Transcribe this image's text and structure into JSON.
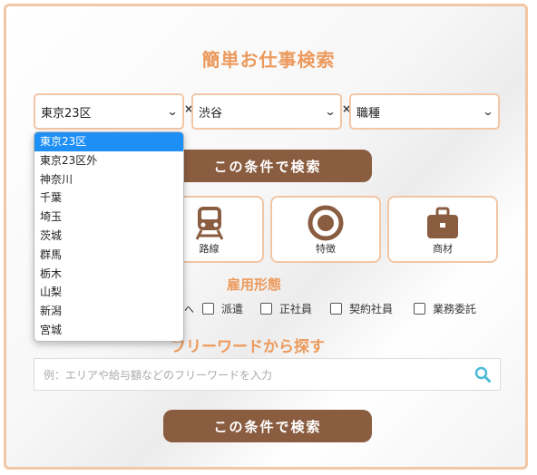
{
  "heading": "簡単お仕事検索",
  "selects": {
    "area": "東京23区",
    "station": "渋谷",
    "job_type": "職種"
  },
  "separator": "×",
  "search_button": "この条件で検索",
  "categories": [
    {
      "label": "路線",
      "icon": "train-icon"
    },
    {
      "label": "特徴",
      "icon": "ring-icon"
    },
    {
      "label": "商材",
      "icon": "briefcase-icon"
    }
  ],
  "employment": {
    "title": "雇用形態",
    "partial_text": "へ",
    "options": [
      "派遣",
      "正社員",
      "契約社員",
      "業務委託"
    ]
  },
  "freeword": {
    "title": "フリーワードから探す",
    "placeholder": "例：エリアや給与額などのフリーワードを入力"
  },
  "dropdown": {
    "selected": "東京23区",
    "options": [
      "東京23区",
      "東京23区外",
      "神奈川",
      "千葉",
      "埼玉",
      "茨城",
      "群馬",
      "栃木",
      "山梨",
      "新潟",
      "宮城"
    ]
  },
  "colors": {
    "accent": "#ec9a5c",
    "border": "#f3c6a4",
    "button": "#8a5c40",
    "highlight": "#1e8ff5"
  }
}
